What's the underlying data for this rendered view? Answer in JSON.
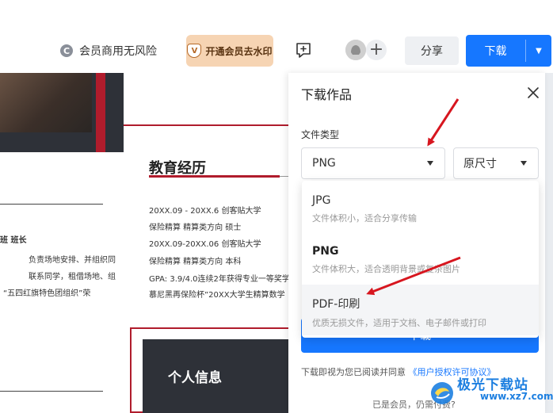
{
  "toolbar": {
    "vip_safe_label": "会员商用无风险",
    "vip_safe_icon": "copyright-c-icon",
    "vip_button_label": "开通会员去水印",
    "vip_badge_letter": "V",
    "share_label": "分享",
    "download_label": "下载",
    "accent_color": "#1677ff",
    "vip_color": "#f6d4b3"
  },
  "resume": {
    "edu_title": "教育经历",
    "edu_lines": [
      "20XX.09 - 20XX.6   创客贴大学",
      "保险精算 精算类方向 硕士",
      "20XX.09-20XX.06   创客贴大学",
      "保险精算 精算类方向 本科",
      "GPA: 3.9/4.0连续2年获得专业一等奖学",
      "慕尼黑再保险杯”20XX大学生精算数学"
    ],
    "left_lines": [
      "班   班长",
      "负责场地安排、并组织同",
      "联系同学，租借场地、组",
      "“五四红旗特色团组织”荣"
    ],
    "info_title": "个人信息",
    "brand_red": "#b01c2c"
  },
  "panel": {
    "title": "下载作品",
    "file_type_label": "文件类型",
    "selected_type": "PNG",
    "selected_size": "原尺寸",
    "options": [
      {
        "name": "JPG",
        "desc": "文件体积小，适合分享传输"
      },
      {
        "name": "PNG",
        "desc": "文件体积大，适合透明背景或复杂图片"
      },
      {
        "name": "PDF-印刷",
        "desc": "优质无损文件，适用于文档、电子邮件或打印"
      }
    ],
    "download_button_label": "下载",
    "agree_text": "下载即视为您已阅读并同意",
    "agree_link": "《用户授权许可协议》",
    "member_text": "已是会员，仍需付费?"
  },
  "watermark": {
    "name": "极光下载站",
    "url": "www.xz7.com"
  }
}
